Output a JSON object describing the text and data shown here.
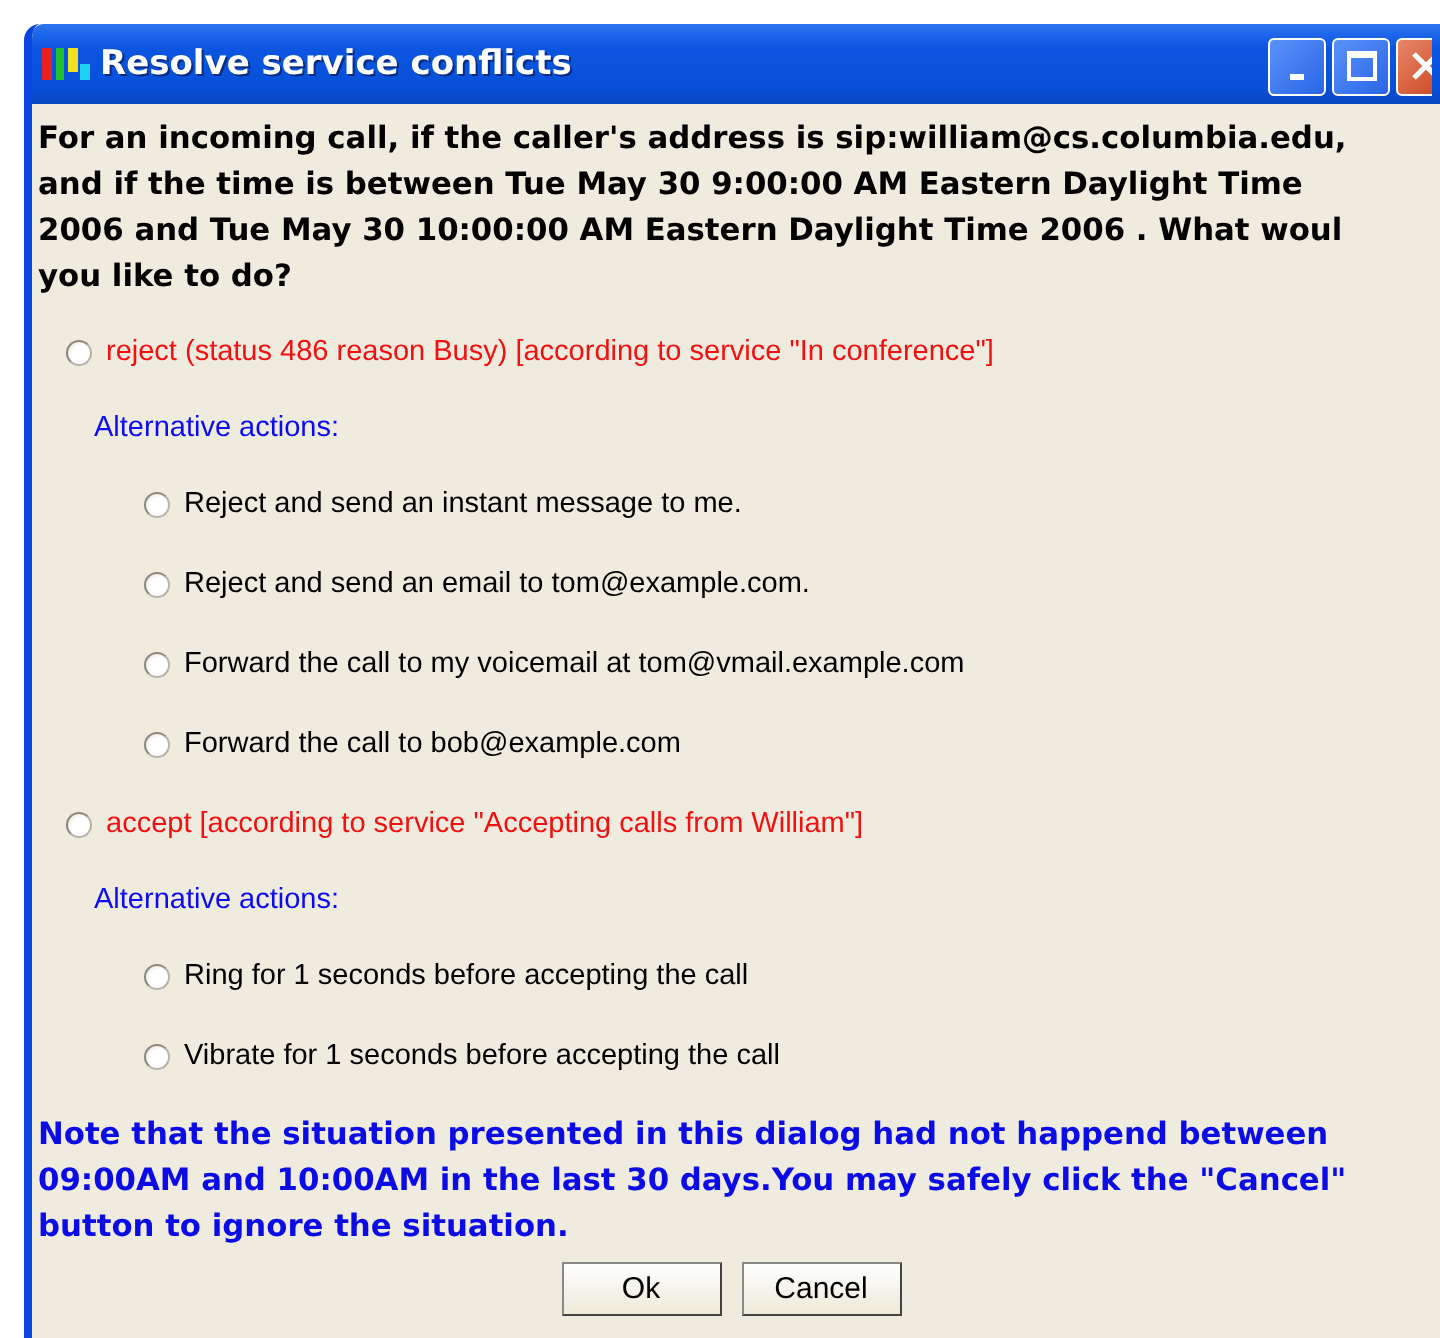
{
  "window": {
    "title": "Resolve service conflicts"
  },
  "question_lines": [
    "For an incoming call, if the caller's address is sip:william@cs.columbia.edu,",
    "and if the time is between Tue May 30 9:00:00 AM Eastern Daylight Time",
    "2006 and Tue May 30 10:00:00 AM Eastern Daylight Time 2006 . What woul",
    "you like to do?"
  ],
  "choices": [
    {
      "label": "reject (status 486 reason Busy) [according to service \"In conference\"]",
      "selected": false,
      "alternatives_label": "Alternative actions:",
      "alternatives": [
        {
          "label": "Reject and send an instant message to me.",
          "selected": false
        },
        {
          "label": "Reject and send an email to tom@example.com.",
          "selected": false
        },
        {
          "label": "Forward the call to my voicemail at tom@vmail.example.com",
          "selected": false
        },
        {
          "label": "Forward the call to bob@example.com",
          "selected": false
        }
      ]
    },
    {
      "label": "accept [according to service \"Accepting calls from William\"]",
      "selected": false,
      "alternatives_label": "Alternative actions:",
      "alternatives": [
        {
          "label": "Ring for 1 seconds before accepting the call",
          "selected": false
        },
        {
          "label": "Vibrate for 1 seconds before accepting the call",
          "selected": false
        }
      ]
    }
  ],
  "note_lines": [
    "Note that the situation presented in this dialog had not happend between",
    "09:00AM and 10:00AM in the last 30 days.You may safely click the \"Cancel\"",
    "button to ignore the situation."
  ],
  "buttons": [
    "Ok",
    "Cancel"
  ]
}
